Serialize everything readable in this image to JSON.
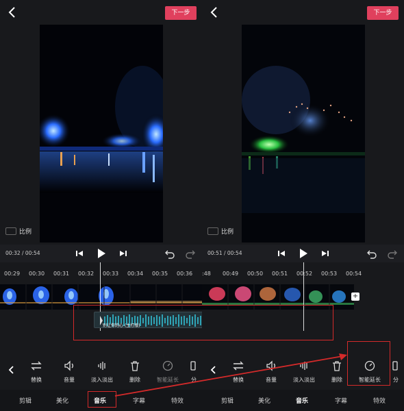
{
  "left": {
    "header": {
      "next_label": "下一步"
    },
    "ratio_label": "比例",
    "timecode": "00:32 / 00:54",
    "ruler": [
      "00:29",
      "00:30",
      "00:31",
      "00:32",
      "00:33",
      "00:34",
      "00:35",
      "00:36"
    ],
    "audio_label": "别让你的心 (主打版)",
    "tools": [
      {
        "label": "替换",
        "icon": "swap-icon",
        "enabled": true
      },
      {
        "label": "音量",
        "icon": "volume-icon",
        "enabled": true
      },
      {
        "label": "淡入淡出",
        "icon": "fade-icon",
        "enabled": true
      },
      {
        "label": "删除",
        "icon": "trash-icon",
        "enabled": true
      },
      {
        "label": "智能延长",
        "icon": "smart-extend-icon",
        "enabled": false
      },
      {
        "label": "分",
        "icon": "split-icon",
        "enabled": true
      }
    ],
    "tabs": [
      {
        "label": "剪辑",
        "active": false
      },
      {
        "label": "美化",
        "active": false
      },
      {
        "label": "音乐",
        "active": true
      },
      {
        "label": "字幕",
        "active": false
      },
      {
        "label": "特效",
        "active": false
      }
    ]
  },
  "right": {
    "header": {
      "next_label": "下一步"
    },
    "ratio_label": "比例",
    "timecode": "00:51 / 00:54",
    "ruler": [
      ":48",
      "00:49",
      "00:50",
      "00:51",
      "00:52",
      "00:53",
      "00:54"
    ],
    "tools": [
      {
        "label": "替换",
        "icon": "swap-icon",
        "enabled": true
      },
      {
        "label": "音量",
        "icon": "volume-icon",
        "enabled": true
      },
      {
        "label": "淡入淡出",
        "icon": "fade-icon",
        "enabled": true
      },
      {
        "label": "删除",
        "icon": "trash-icon",
        "enabled": true
      },
      {
        "label": "智能延长",
        "icon": "smart-extend-icon",
        "enabled": true
      },
      {
        "label": "分",
        "icon": "split-icon",
        "enabled": true
      }
    ],
    "tabs": [
      {
        "label": "剪辑",
        "active": false
      },
      {
        "label": "美化",
        "active": false
      },
      {
        "label": "音乐",
        "active": true
      },
      {
        "label": "字幕",
        "active": false
      },
      {
        "label": "特效",
        "active": false
      }
    ]
  },
  "colors": {
    "accent": "#e0405d",
    "annotation": "#d42a2a",
    "waveform": "#2fa3b5",
    "background": "#18191c"
  }
}
